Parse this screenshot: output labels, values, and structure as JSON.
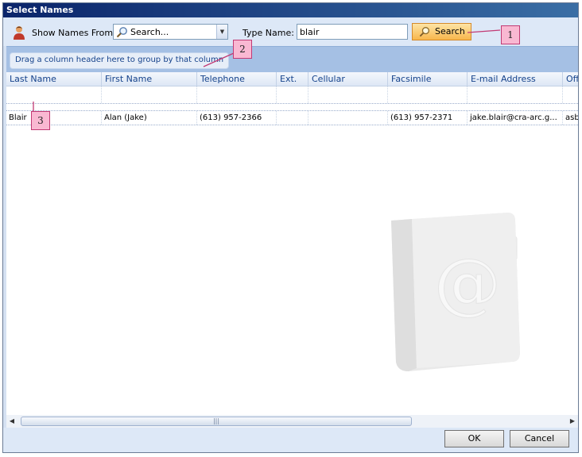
{
  "window": {
    "title": "Select Names"
  },
  "toolbar": {
    "show_names_label": "Show Names From:",
    "show_names_value": "Search...",
    "type_name_label": "Type Name:",
    "type_name_value": "blair",
    "search_label": "Search"
  },
  "group_panel": {
    "hint": "Drag a column header here to group by that column"
  },
  "grid": {
    "columns": [
      "Last Name",
      "First Name",
      "Telephone",
      "Ext.",
      "Cellular",
      "Facsimile",
      "E-mail Address",
      "Off"
    ],
    "rows": [
      [
        "Blair",
        "Alan (Jake)",
        "(613) 957-2366",
        "",
        "",
        "(613) 957-2371",
        "jake.blair@cra-arc.g...",
        "asb"
      ]
    ]
  },
  "footer": {
    "ok_label": "OK",
    "cancel_label": "Cancel"
  },
  "callouts": [
    "1",
    "2",
    "3"
  ],
  "colors": {
    "callout_fill": "#f9b8d2",
    "callout_border": "#c23a74",
    "title_bar": "#0a246a",
    "group_panel": "#a5c0e4"
  }
}
